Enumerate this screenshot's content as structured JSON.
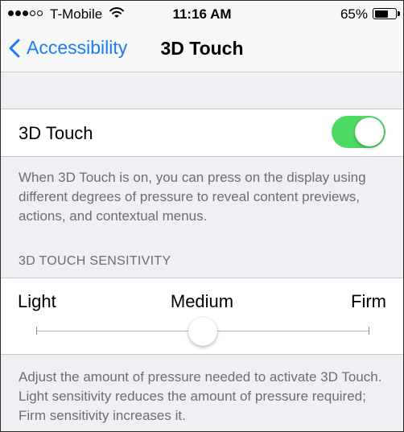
{
  "status_bar": {
    "carrier": "T-Mobile",
    "time": "11:16 AM",
    "battery_percent": "65%",
    "battery_level": 0.65,
    "signal_bars_filled": 3,
    "signal_bars_total": 5
  },
  "nav": {
    "back_label": "Accessibility",
    "title": "3D Touch"
  },
  "toggle_cell": {
    "label": "3D Touch",
    "enabled": true
  },
  "toggle_footer": "When 3D Touch is on, you can press on the display using different degrees of pressure to reveal content previews, actions, and contextual menus.",
  "sensitivity": {
    "header": "3D TOUCH SENSITIVITY",
    "labels": [
      "Light",
      "Medium",
      "Firm"
    ],
    "selected": "Medium",
    "level": 0.5
  },
  "sensitivity_footer": "Adjust the amount of pressure needed to activate 3D Touch. Light sensitivity reduces the amount of pressure required; Firm sensitivity increases it.",
  "colors": {
    "accent": "#1a7cf5",
    "switch_on": "#4cd964",
    "background": "#efeff4",
    "secondary_text": "#6d6d72"
  }
}
